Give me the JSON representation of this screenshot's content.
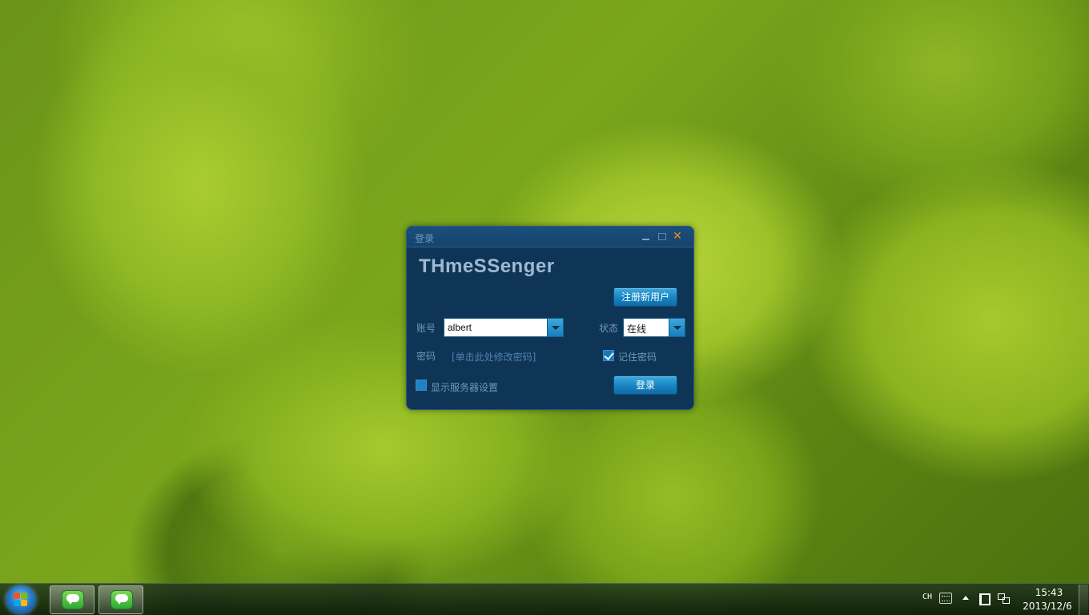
{
  "window": {
    "title": "登录",
    "logo": "THmeSSenger",
    "register_label": "注册新用户",
    "account_label": "账号",
    "account_value": "albert",
    "status_label": "状态",
    "status_value": "在线",
    "password_label": "密码",
    "password_link": "[单击此处修改密码]",
    "remember_label": "记住密码",
    "remember_checked": true,
    "server_settings_label": "显示服务器设置",
    "server_settings_checked": false,
    "login_label": "登录",
    "colors": {
      "accent": "#1a84c4",
      "background": "#0f3556",
      "close": "#f08a1c"
    }
  },
  "taskbar": {
    "start_icon": "windows-start-icon",
    "apps": [
      {
        "icon": "chat-bubble-icon"
      },
      {
        "icon": "chat-bubble-icon"
      }
    ],
    "tray": {
      "language": "CH",
      "time": "15:43",
      "date": "2013/12/6"
    }
  }
}
